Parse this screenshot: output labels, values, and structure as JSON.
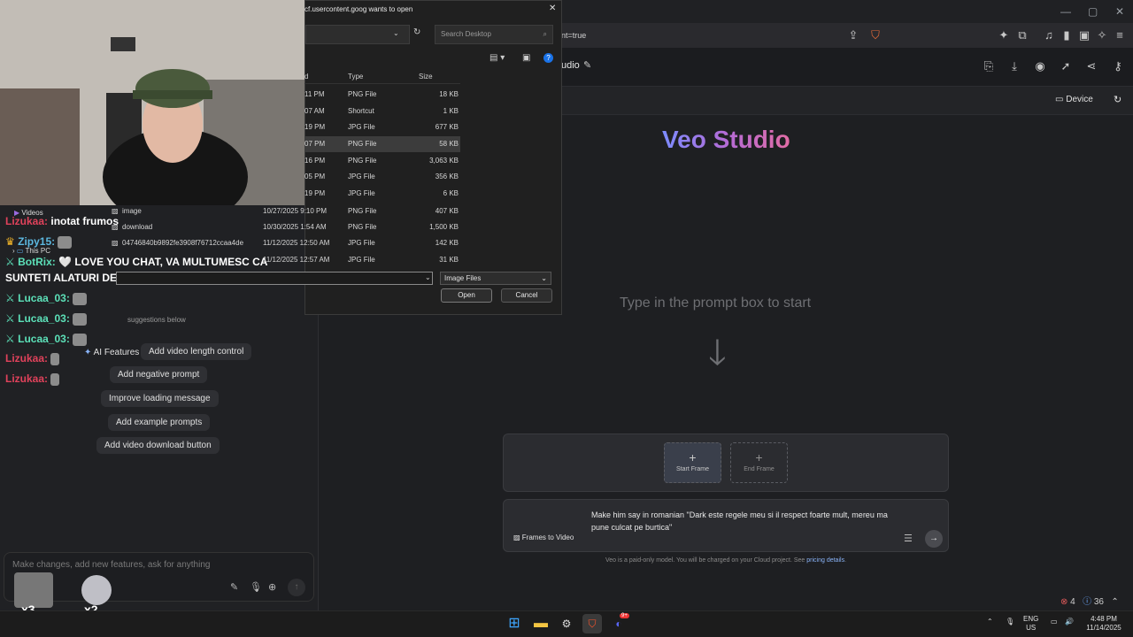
{
  "browser": {
    "url_fragment": "nt=true",
    "window_controls": [
      "—",
      "▢",
      "✕"
    ]
  },
  "app": {
    "studio_label": "udio",
    "device_label": "Device"
  },
  "veo": {
    "title": "Veo Studio",
    "prompt_hint": "Type in the prompt box to start",
    "arrow": "🡓",
    "start_frame": "Start Frame",
    "end_frame": "End Frame",
    "prompt_text": "Make him say in romanian \"Dark este regele meu si il respect foarte mult, mereu ma pune culcat pe burtica\"",
    "mode_label": "Frames to Video",
    "footer_prefix": "Veo is a paid-only model. You will be charged on your Cloud project. See ",
    "footer_link": "pricing details",
    "footer_suffix": "."
  },
  "file_dialog": {
    "title": "cf.usercontent.goog wants to open",
    "search_placeholder": "Search Desktop",
    "col_date": "d",
    "col_type": "Type",
    "col_size": "Size",
    "rows": [
      {
        "date": "11 PM",
        "type": "PNG File",
        "size": "18 KB"
      },
      {
        "date": "07 AM",
        "type": "Shortcut",
        "size": "1 KB"
      },
      {
        "date": "19 PM",
        "type": "JPG File",
        "size": "677 KB"
      },
      {
        "date": "07 PM",
        "type": "PNG File",
        "size": "58 KB"
      },
      {
        "date": "16 PM",
        "type": "PNG File",
        "size": "3,063 KB"
      },
      {
        "date": "05 PM",
        "type": "JPG File",
        "size": "356 KB"
      },
      {
        "date": "19 PM",
        "type": "JPG File",
        "size": "6 KB"
      }
    ],
    "full_rows": [
      {
        "name": "image",
        "date": "10/27/2025 9:10 PM",
        "type": "PNG File",
        "size": "407 KB"
      },
      {
        "name": "download",
        "date": "10/30/2025 1:54 AM",
        "type": "PNG File",
        "size": "1,500 KB"
      },
      {
        "name": "04746840b9892fe3908f76712ccaa4de",
        "date": "11/12/2025 12:50 AM",
        "type": "JPG File",
        "size": "142 KB"
      },
      {
        "name": "",
        "date": "11/12/2025 12:57 AM",
        "type": "JPG File",
        "size": "31 KB"
      }
    ],
    "nav_items": [
      "Videos",
      "This PC"
    ],
    "filter": "Image Files",
    "open_label": "Open",
    "cancel_label": "Cancel"
  },
  "chat": {
    "lines": [
      {
        "user": "Lizukaa:",
        "text": "inotat frumos",
        "color": "#e0425b"
      },
      {
        "user": "Zipy15:",
        "text": "",
        "color": "#5cb8e0"
      },
      {
        "user": "BotRix:",
        "text": "🤍 LOVE YOU CHAT, VA MULTUMESC CA",
        "color": "#5ce0b8"
      },
      {
        "user": "",
        "text": "SUNTETI ALATURI DE MINE 🤍",
        "color": "#ffffff"
      },
      {
        "user": "Lucaa_03:",
        "text": "",
        "color": "#5ce0b8"
      },
      {
        "user": "Lucaa_03:",
        "text": "",
        "color": "#5ce0b8"
      },
      {
        "user": "Lucaa_03:",
        "text": "",
        "color": "#5ce0b8"
      },
      {
        "user": "Lizukaa:",
        "text": "",
        "color": "#e0425b"
      },
      {
        "user": "Lizukaa:",
        "text": "",
        "color": "#e0425b"
      }
    ]
  },
  "left_panel": {
    "suggestions_caption": "suggestions below",
    "suggestions": [
      "AI Features",
      "Add video length control",
      "Add negative prompt",
      "Improve loading message",
      "Add example prompts",
      "Add video download button"
    ],
    "composer_placeholder": "Make changes, add new features, ask for anything",
    "emote_counts": [
      "x3",
      "x2"
    ]
  },
  "status": {
    "errors": "4",
    "info": "36"
  },
  "taskbar": {
    "lang_line1": "ENG",
    "lang_line2": "US",
    "time": "4:48 PM",
    "date": "11/14/2025",
    "discord_badge": "9+"
  }
}
